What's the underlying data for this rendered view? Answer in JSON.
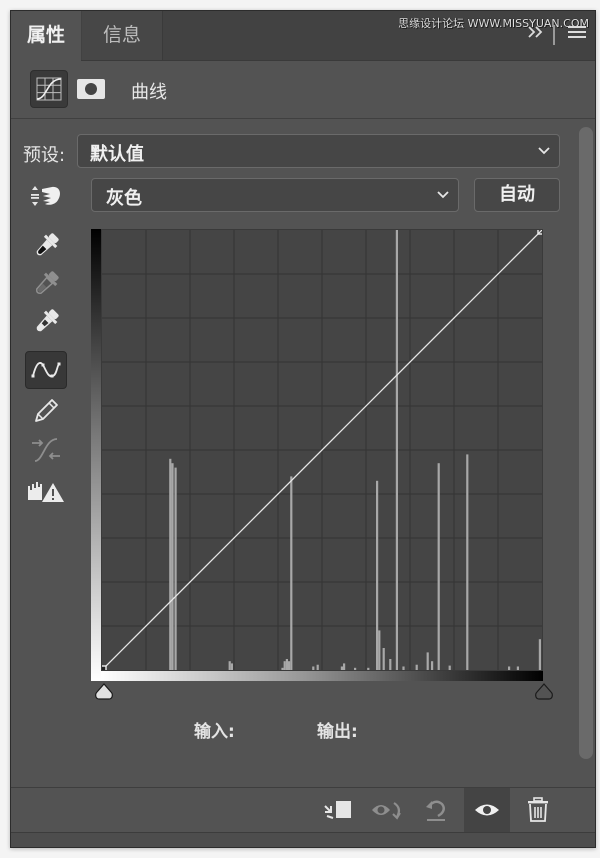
{
  "tabs": [
    {
      "label": "属性",
      "active": true
    },
    {
      "label": "信息",
      "active": false
    }
  ],
  "tab_controls": {
    "collapse_icon": "double-chevron-right",
    "menu_icon": "hamburger-menu"
  },
  "watermark": "思缘设计论坛 WWW.MISSYUAN.COM",
  "header": {
    "adjustment_icon": "curves-adjustment-icon",
    "mask_icon": "layer-mask-icon",
    "title": "曲线"
  },
  "preset": {
    "label": "预设:",
    "value": "默认值"
  },
  "channel": {
    "value": "灰色",
    "auto_button": "自动"
  },
  "tools": [
    {
      "name": "on-image-adjust",
      "icon": "target-adjust-icon",
      "active": false
    },
    {
      "name": "black-point-eyedropper",
      "icon": "eyedropper-black-icon",
      "active": false
    },
    {
      "name": "gray-point-eyedropper",
      "icon": "eyedropper-gray-icon",
      "active": false
    },
    {
      "name": "white-point-eyedropper",
      "icon": "eyedropper-white-icon",
      "active": false
    },
    {
      "name": "edit-points",
      "icon": "curve-points-icon",
      "active": true
    },
    {
      "name": "draw-pencil",
      "icon": "pencil-icon",
      "active": false
    },
    {
      "name": "smooth-curve",
      "icon": "smooth-curve-icon",
      "active": false
    },
    {
      "name": "clipping-warning",
      "icon": "histogram-warning-icon",
      "active": false
    }
  ],
  "curve": {
    "points": [
      [
        0,
        0
      ],
      [
        255,
        255
      ]
    ],
    "grid_divisions": 10,
    "histogram": [
      {
        "x": 0.155,
        "h": 0.48
      },
      {
        "x": 0.16,
        "h": 0.47
      },
      {
        "x": 0.167,
        "h": 0.46
      },
      {
        "x": 0.29,
        "h": 0.02
      },
      {
        "x": 0.295,
        "h": 0.015
      },
      {
        "x": 0.41,
        "h": 0.005
      },
      {
        "x": 0.415,
        "h": 0.02
      },
      {
        "x": 0.42,
        "h": 0.025
      },
      {
        "x": 0.425,
        "h": 0.02
      },
      {
        "x": 0.43,
        "h": 0.44
      },
      {
        "x": 0.48,
        "h": 0.008
      },
      {
        "x": 0.49,
        "h": 0.012
      },
      {
        "x": 0.545,
        "h": 0.008
      },
      {
        "x": 0.55,
        "h": 0.015
      },
      {
        "x": 0.575,
        "h": 0.005
      },
      {
        "x": 0.605,
        "h": 0.005
      },
      {
        "x": 0.625,
        "h": 0.43
      },
      {
        "x": 0.63,
        "h": 0.09
      },
      {
        "x": 0.64,
        "h": 0.05
      },
      {
        "x": 0.655,
        "h": 0.025
      },
      {
        "x": 0.67,
        "h": 1.0
      },
      {
        "x": 0.685,
        "h": 0.008
      },
      {
        "x": 0.715,
        "h": 0.012
      },
      {
        "x": 0.74,
        "h": 0.04
      },
      {
        "x": 0.75,
        "h": 0.02
      },
      {
        "x": 0.765,
        "h": 0.47
      },
      {
        "x": 0.79,
        "h": 0.01
      },
      {
        "x": 0.83,
        "h": 0.49
      },
      {
        "x": 0.925,
        "h": 0.008
      },
      {
        "x": 0.945,
        "h": 0.008
      },
      {
        "x": 0.995,
        "h": 0.07
      }
    ]
  },
  "io": {
    "input_label": "输入:",
    "output_label": "输出:"
  },
  "bottom_toolbar": [
    {
      "name": "clip-to-layer",
      "icon": "clip-to-layer-icon",
      "active": false
    },
    {
      "name": "view-previous-state",
      "icon": "eye-cycle-icon",
      "active": false
    },
    {
      "name": "reset-defaults",
      "icon": "reset-icon",
      "active": false
    },
    {
      "name": "toggle-visibility",
      "icon": "eye-icon",
      "active": true
    },
    {
      "name": "delete-layer",
      "icon": "trash-icon",
      "active": false
    }
  ]
}
